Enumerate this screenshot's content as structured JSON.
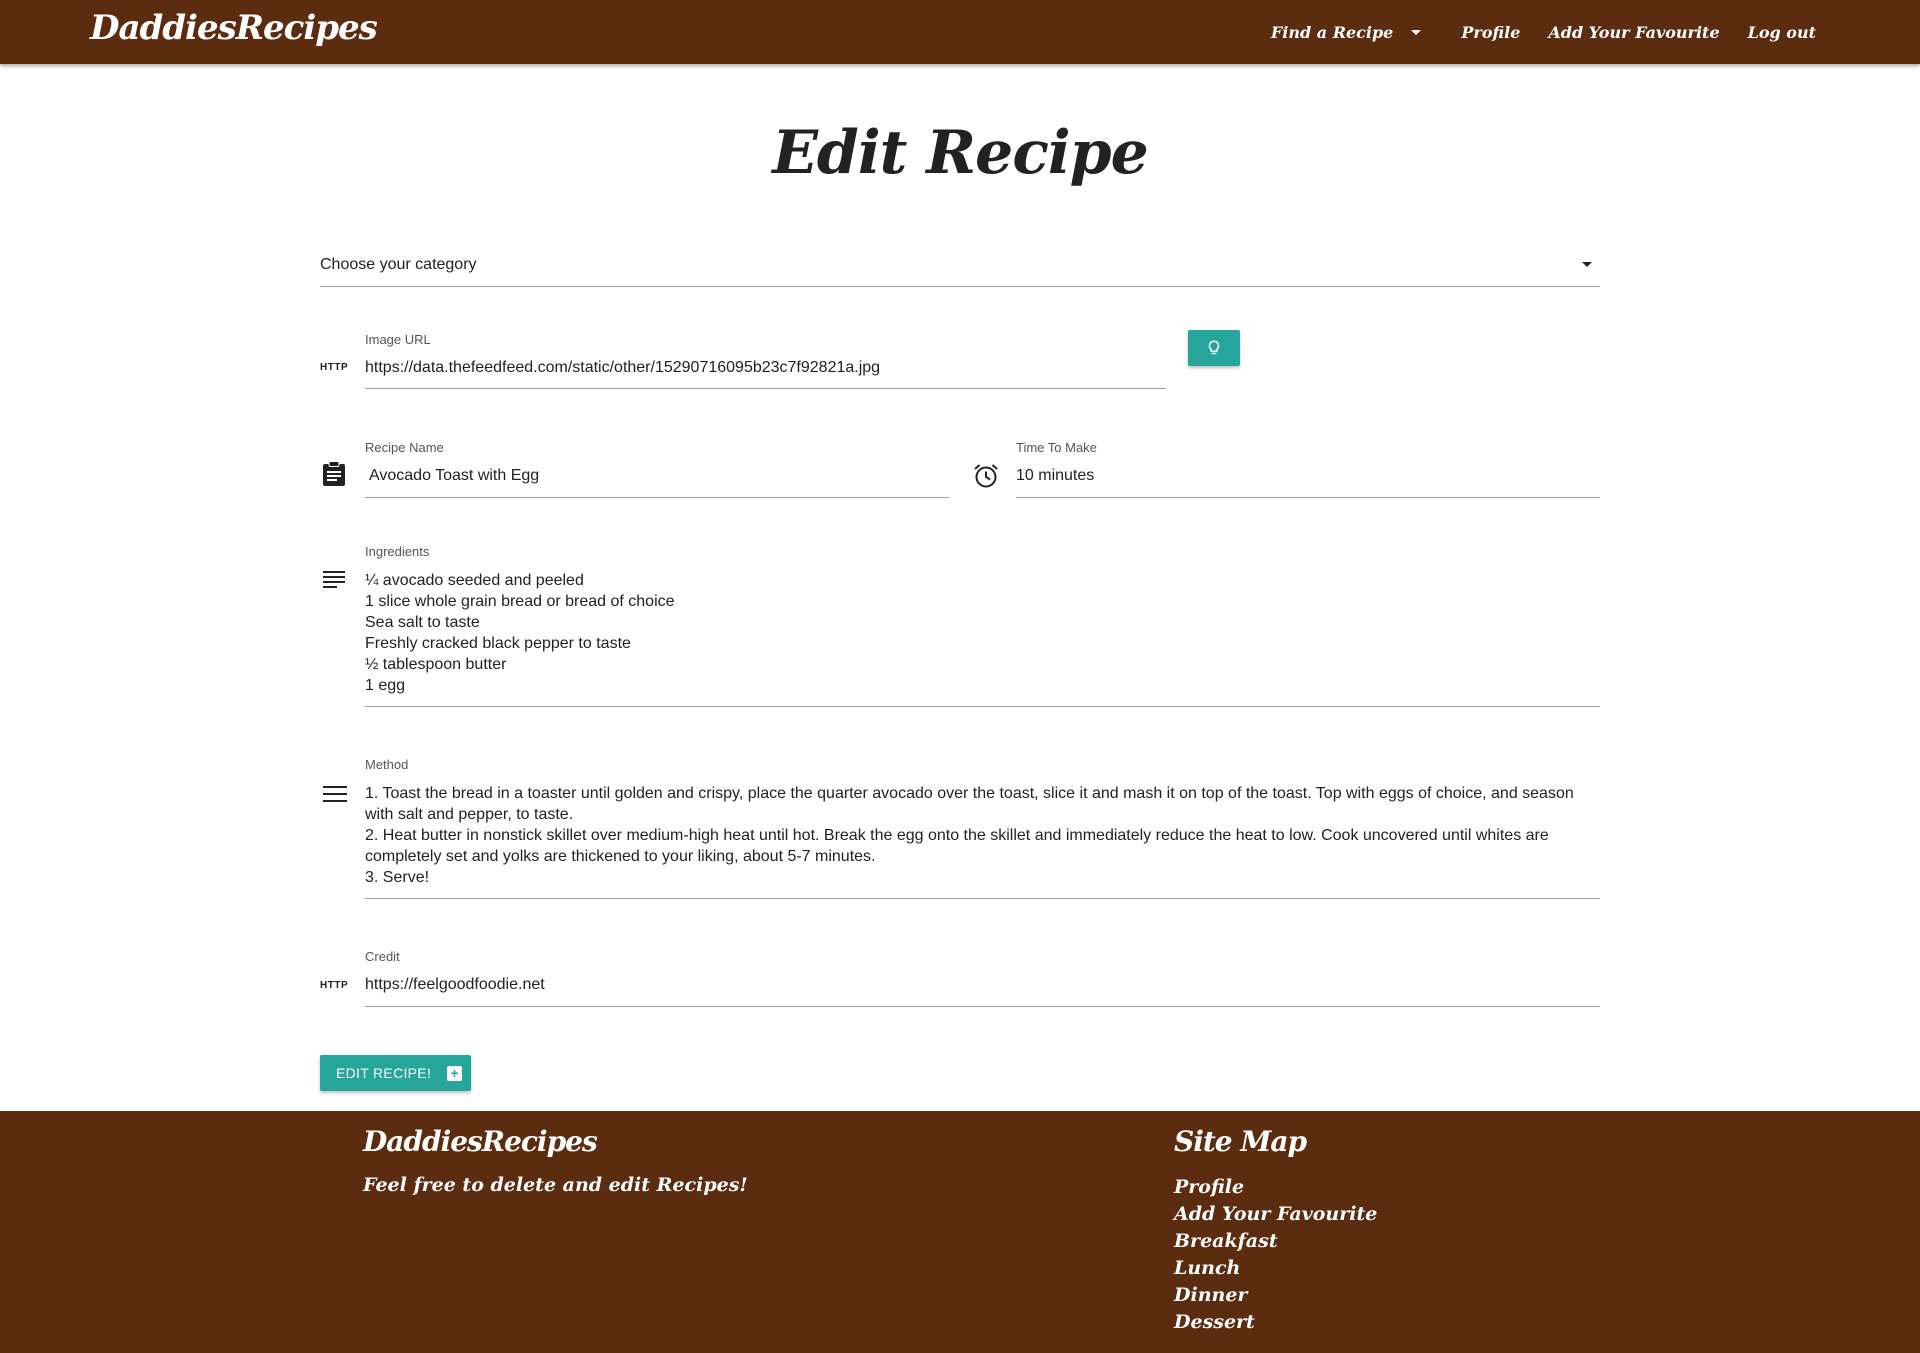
{
  "navbar": {
    "brand": "DaddiesRecipes",
    "links": [
      "Find a Recipe",
      "Profile",
      "Add Your Favourite",
      "Log out"
    ]
  },
  "page": {
    "title": "Edit Recipe"
  },
  "form": {
    "category": {
      "value": "Choose your category"
    },
    "image_url": {
      "prefix": "HTTP",
      "label": "Image URL",
      "value": "https://data.thefeedfeed.com/static/other/15290716095b23c7f92821a.jpg"
    },
    "recipe_name": {
      "label": "Recipe Name",
      "value": "Avocado Toast with Egg"
    },
    "time_to_make": {
      "label": "Time To Make",
      "value": "10 minutes"
    },
    "ingredients": {
      "label": "Ingredients",
      "lines": [
        "¼ avocado seeded and peeled",
        "1 slice whole grain bread or bread of choice",
        "Sea salt to taste",
        "Freshly cracked black pepper to taste",
        "½ tablespoon butter",
        "1 egg"
      ]
    },
    "method": {
      "label": "Method",
      "lines": [
        "1.  Toast the bread in a toaster until golden and crispy, place the quarter avocado over the toast, slice it and mash it on top of the toast. Top with eggs of choice, and season with salt and pepper, to taste.",
        "2.   Heat butter in nonstick skillet over medium-high heat until hot. Break the egg onto the skillet and immediately reduce the heat to low. Cook uncovered until whites are completely set and yolks are thickened to your liking, about 5-7 minutes.",
        "3.  Serve!"
      ]
    },
    "credit": {
      "prefix": "HTTP",
      "label": "Credit",
      "value": "https://feelgoodfoodie.net"
    },
    "submit_label": "EDIT RECIPE!"
  },
  "footer": {
    "brand": "DaddiesRecipes",
    "tagline": "Feel free to delete and edit Recipes!",
    "sitemap_title": "Site Map",
    "sitemap": [
      "Profile",
      "Add Your Favourite",
      "Breakfast",
      "Lunch",
      "Dinner",
      "Dessert"
    ]
  },
  "colors": {
    "brand": "#5b2c0f",
    "accent": "#26a69a"
  },
  "icons": [
    "lightbulb-icon",
    "clipboard-icon",
    "alarm-clock-icon",
    "subject-icon",
    "menu-lines-icon",
    "add-box-icon",
    "dropdown-arrow-icon"
  ]
}
